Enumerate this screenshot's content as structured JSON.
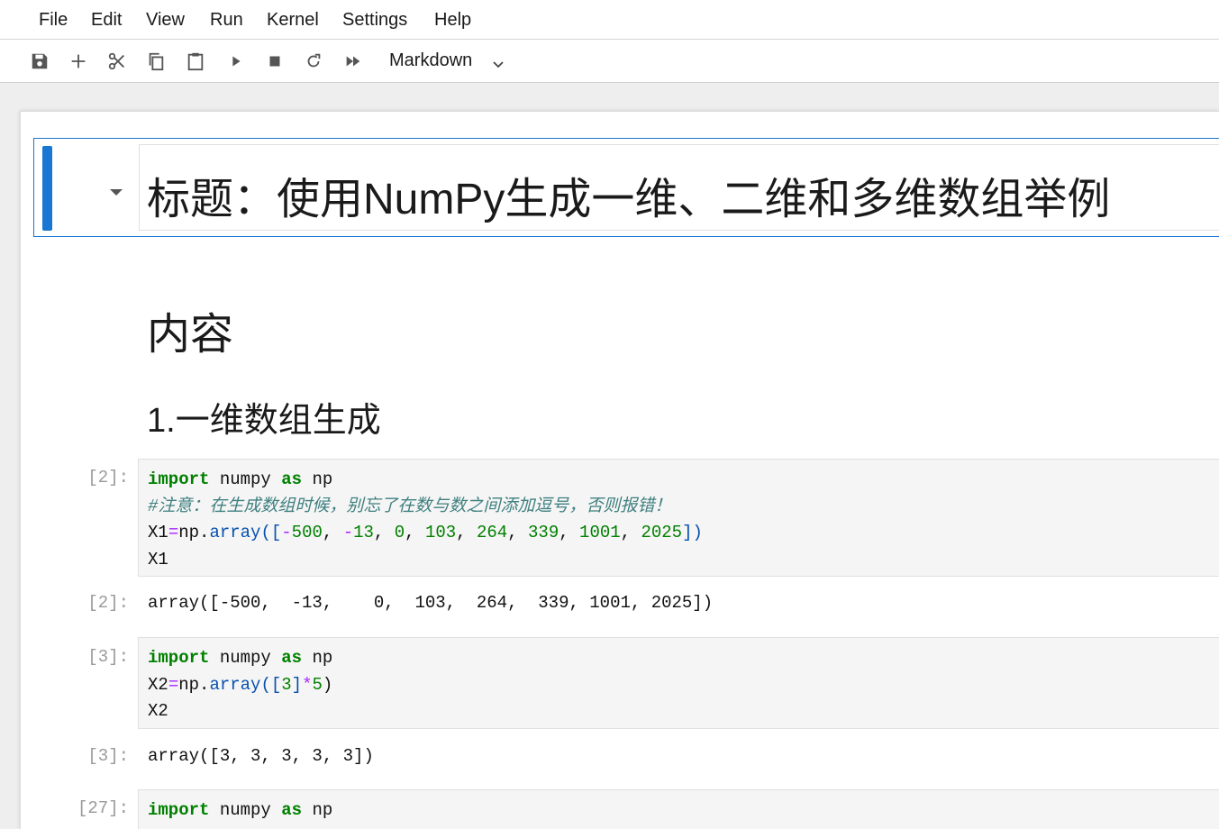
{
  "menu": [
    "File",
    "Edit",
    "View",
    "Run",
    "Kernel",
    "Settings",
    "Help"
  ],
  "toolbar": {
    "icons": [
      "save-icon",
      "add-cell-icon",
      "cut-icon",
      "copy-icon",
      "paste-icon",
      "run-icon",
      "stop-icon",
      "restart-icon",
      "run-all-icon"
    ],
    "cell_type": "Markdown"
  },
  "notebook": {
    "title_heading": "标题：使用NumPy生成一维、二维和多维数组举例",
    "section_heading": "内容",
    "subsection_heading": "1.一维数组生成",
    "cells": [
      {
        "prompt": "[2]:",
        "code": {
          "l1": [
            "import",
            " numpy ",
            "as",
            " np"
          ],
          "l2": "#注意：在生成数组时候，别忘了在数与数之间添加逗号，否则报错！",
          "l3": [
            "X1",
            "=",
            "np.",
            "array",
            "([",
            "-",
            "500",
            ", ",
            "-",
            "13",
            ", ",
            "0",
            ", ",
            "103",
            ", ",
            "264",
            ", ",
            "339",
            ", ",
            "1001",
            ", ",
            "2025",
            "])"
          ],
          "l4": "X1"
        },
        "out_prompt": "[2]:",
        "output": "array([-500,  -13,    0,  103,  264,  339, 1001, 2025])"
      },
      {
        "prompt": "[3]:",
        "code": {
          "l1": [
            "import",
            " numpy ",
            "as",
            " np"
          ],
          "l2": [
            "X2",
            "=",
            "np.",
            "array",
            "([",
            "3",
            "]",
            "*",
            "5",
            ")"
          ],
          "l3": "X2"
        },
        "out_prompt": "[3]:",
        "output": "array([3, 3, 3, 3, 3])"
      },
      {
        "prompt": "[27]:",
        "code": {
          "l1": [
            "import",
            " numpy ",
            "as",
            " np"
          ]
        }
      }
    ]
  }
}
